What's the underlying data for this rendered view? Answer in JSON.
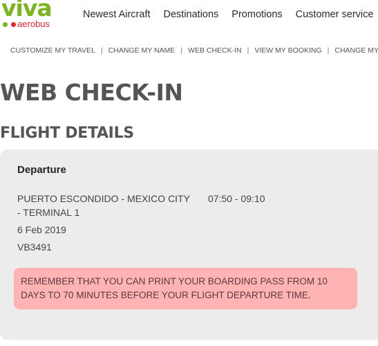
{
  "brand": {
    "logo_word": "viva",
    "logo_sub": "aerobus",
    "colors": {
      "green": "#7ab51d",
      "red": "#e3262e"
    }
  },
  "top_nav": {
    "items": [
      "Newest Aircraft",
      "Destinations",
      "Promotions",
      "Customer service"
    ]
  },
  "sub_nav": {
    "items": [
      "CUSTOMIZE MY TRAVEL",
      "CHANGE MY NAME",
      "WEB CHECK-IN",
      "VIEW MY BOOKING",
      "CHANGE MY BO"
    ],
    "separator": "|"
  },
  "page_title": "WEB CHECK-IN",
  "section_title": "FLIGHT DETAILS",
  "flight": {
    "heading": "Departure",
    "route": "PUERTO ESCONDIDO - MEXICO CITY - TERMINAL 1",
    "times": "07:50 - 09:10",
    "date": "6 Feb 2019",
    "flight_number": "VB3491"
  },
  "notice": {
    "text": "REMEMBER THAT YOU CAN PRINT YOUR BOARDING PASS FROM 10 DAYS TO 70 MINUTES BEFORE YOUR FLIGHT DEPARTURE TIME.",
    "color": "#ffb3b3"
  }
}
